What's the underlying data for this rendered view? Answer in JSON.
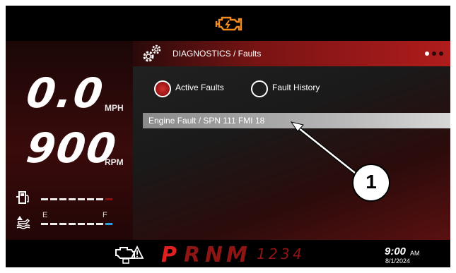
{
  "topbar": {
    "warning_icon": "check-engine-icon",
    "warning_color": "#f28c1c"
  },
  "left": {
    "speed_value": "0.0",
    "speed_unit": "MPH",
    "rpm_value": "900",
    "rpm_unit": "RPM",
    "fuel_icon": "fuel-pump-icon",
    "fuel_level": 0.75,
    "water_icon": "water-tank-icon",
    "water_label_empty": "E",
    "water_label_full": "F",
    "water_level": 0.75
  },
  "header": {
    "gear_icon": "gears-icon",
    "title": "DIAGNOSTICS / Faults",
    "page_dots": 3
  },
  "options": {
    "active_label": "Active Faults",
    "history_label": "Fault History",
    "selected": "Active Faults"
  },
  "faults": [
    {
      "text": "Engine Fault / SPN 111 FMI 18"
    }
  ],
  "bottom": {
    "engine_icon": "engine-warning-icon",
    "gears": [
      "P",
      "R",
      "N",
      "M"
    ],
    "gear_numbers": [
      "1",
      "2",
      "3",
      "4"
    ],
    "time": "9:00",
    "ampm": "AM",
    "date": "8/1/2024"
  },
  "callout": {
    "number": "1"
  },
  "colors": {
    "accent_red": "#b01c1c",
    "fuel_end": "#8a1010",
    "water_end": "#2aa0e0",
    "gear_red": "#c01818"
  }
}
